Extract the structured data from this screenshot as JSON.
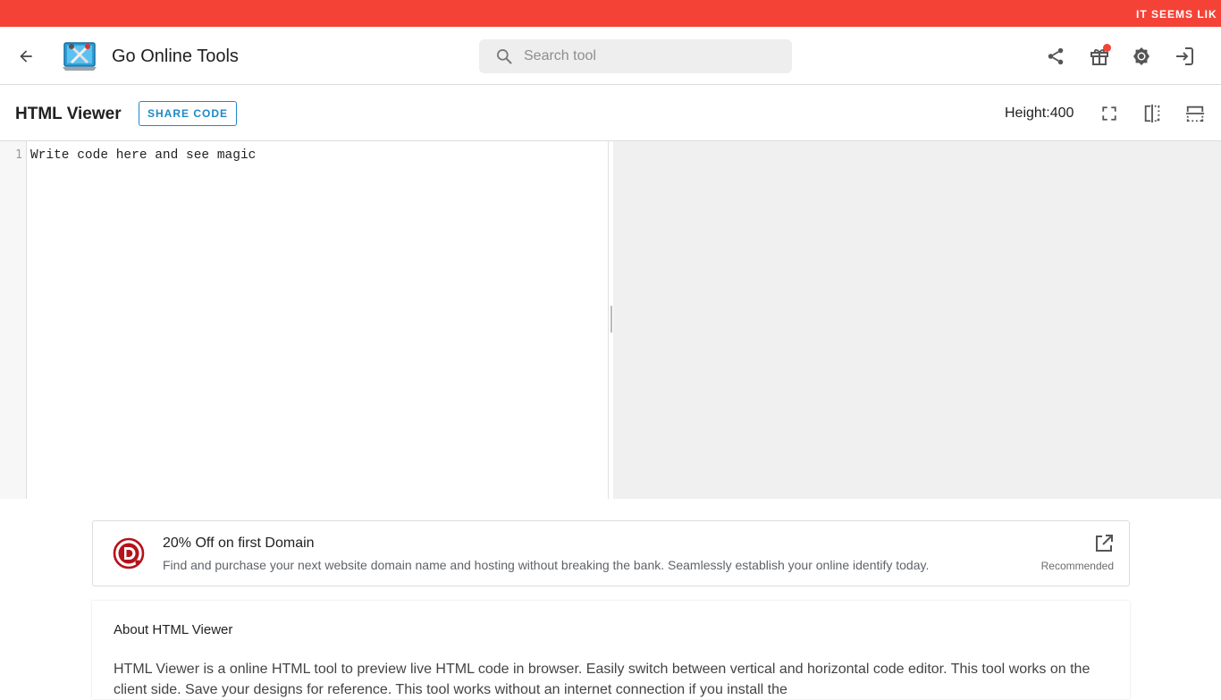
{
  "banner": {
    "text": "IT SEEMS LIK"
  },
  "appbar": {
    "title": "Go Online Tools",
    "search_placeholder": "Search tool",
    "back_icon": "arrow-back-icon",
    "icons": [
      "share-icon",
      "gift-icon",
      "theme-icon",
      "login-icon"
    ]
  },
  "toolbar": {
    "title": "HTML Viewer",
    "share_label": "SHARE CODE",
    "height_label": "Height:",
    "height_value": "400",
    "icons": [
      "fullscreen-icon",
      "vertical-split-icon",
      "horizontal-split-icon"
    ]
  },
  "editor": {
    "line_number": "1",
    "code": "Write code here and see magic"
  },
  "promo": {
    "title": "20% Off on first Domain",
    "description": "Find and purchase your next website domain name and hosting without breaking the bank. Seamlessly establish your online identify today.",
    "badge": "Recommended"
  },
  "about": {
    "title": "About HTML Viewer",
    "text": "HTML Viewer is a online HTML tool to preview live HTML code in browser. Easily switch between vertical and horizontal code editor. This tool works on the client side. Save your designs for reference. This tool works without an internet connection if you install the"
  },
  "colors": {
    "banner": "#f44336",
    "accent": "#1e88c8",
    "preview_bg": "#f0f0f0"
  }
}
